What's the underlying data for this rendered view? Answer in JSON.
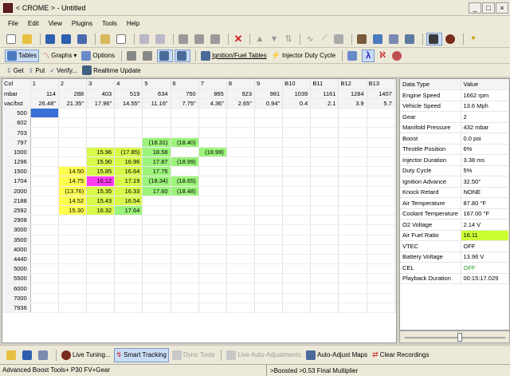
{
  "title": "< CROME > - Untitled",
  "menu": [
    "File",
    "Edit",
    "View",
    "Plugins",
    "Tools",
    "Help"
  ],
  "toolbar2": {
    "tables": "Tables",
    "graphs": "Graphs",
    "options": "Options",
    "ignfuel": "Ignition/Fuel Tables",
    "injdc": "Injector Duty Cycle"
  },
  "toolbar3": {
    "get": "Get",
    "put": "Put",
    "verify": "Verify...",
    "realtime": "Realtime Update"
  },
  "grid": {
    "header": [
      "Col",
      "1",
      "2",
      "3",
      "4",
      "5",
      "6",
      "7",
      "8",
      "9",
      "B10",
      "B11",
      "B12",
      "B13",
      "B14"
    ],
    "mbar": [
      "mbar",
      "114",
      "288",
      "403",
      "519",
      "634",
      "750",
      "865",
      "923",
      "981",
      "1039",
      "1161",
      "1284",
      "1407",
      "1530"
    ],
    "vac": [
      "vac/bst",
      "26.48\"",
      "21.35\"",
      "17.96\"",
      "14.55\"",
      "11.16\"",
      "7.75\"",
      "4.36\"",
      "2.65\"",
      "0.94\"",
      "0.4",
      "2.1",
      "3.9",
      "5.7",
      "7.5"
    ],
    "rows": [
      {
        "rpm": "500",
        "cells": [
          "",
          "",
          "",
          "",
          "",
          "",
          "",
          "",
          "",
          "",
          "",
          "",
          "",
          ""
        ]
      },
      {
        "rpm": "602",
        "cells": [
          "",
          "",
          "",
          "",
          "",
          "",
          "",
          "",
          "",
          "",
          "",
          "",
          "",
          ""
        ]
      },
      {
        "rpm": "703",
        "cells": [
          "",
          "",
          "",
          "",
          "",
          "",
          "",
          "",
          "",
          "",
          "",
          "",
          "",
          ""
        ]
      },
      {
        "rpm": "797",
        "cells": [
          "",
          "",
          "",
          "",
          "(18.31)",
          "(18.40)",
          "",
          "",
          "",
          "",
          "",
          "",
          "",
          ""
        ]
      },
      {
        "rpm": "1000",
        "cells": [
          "",
          "",
          "15.96",
          "(17.85)",
          "18.58",
          "",
          "(18.99)",
          "",
          "",
          "",
          "",
          "",
          "",
          ""
        ]
      },
      {
        "rpm": "1296",
        "cells": [
          "",
          "",
          "15.90",
          "16.96",
          "17.87",
          "(18.99)",
          "",
          "",
          "",
          "",
          "",
          "",
          "",
          ""
        ]
      },
      {
        "rpm": "1500",
        "cells": [
          "",
          "14.50",
          "15.85",
          "16.64",
          "17.75",
          "",
          "",
          "",
          "",
          "",
          "",
          "",
          "",
          ""
        ]
      },
      {
        "rpm": "1704",
        "cells": [
          "",
          "14.75",
          "16.12",
          "17.19",
          "(18.34)",
          "(18.65)",
          "",
          "",
          "",
          "",
          "",
          "",
          "",
          ""
        ]
      },
      {
        "rpm": "2000",
        "cells": [
          "",
          "(13.76)",
          "15.35",
          "16.33",
          "17.60",
          "(18.48)",
          "",
          "",
          "",
          "",
          "",
          "",
          "",
          ""
        ]
      },
      {
        "rpm": "2188",
        "cells": [
          "",
          "14.52",
          "15.43",
          "16.54",
          "",
          "",
          "",
          "",
          "",
          "",
          "",
          "",
          "",
          ""
        ]
      },
      {
        "rpm": "2592",
        "cells": [
          "",
          "15.30",
          "16.32",
          "17.64",
          "",
          "",
          "",
          "",
          "",
          "",
          "",
          "",
          "",
          ""
        ]
      },
      {
        "rpm": "2908",
        "cells": [
          "",
          "",
          "",
          "",
          "",
          "",
          "",
          "",
          "",
          "",
          "",
          "",
          "",
          ""
        ]
      },
      {
        "rpm": "3000",
        "cells": [
          "",
          "",
          "",
          "",
          "",
          "",
          "",
          "",
          "",
          "",
          "",
          "",
          "",
          ""
        ]
      },
      {
        "rpm": "3500",
        "cells": [
          "",
          "",
          "",
          "",
          "",
          "",
          "",
          "",
          "",
          "",
          "",
          "",
          "",
          ""
        ]
      },
      {
        "rpm": "4000",
        "cells": [
          "",
          "",
          "",
          "",
          "",
          "",
          "",
          "",
          "",
          "",
          "",
          "",
          "",
          ""
        ]
      },
      {
        "rpm": "4440",
        "cells": [
          "",
          "",
          "",
          "",
          "",
          "",
          "",
          "",
          "",
          "",
          "",
          "",
          "",
          ""
        ]
      },
      {
        "rpm": "5000",
        "cells": [
          "",
          "",
          "",
          "",
          "",
          "",
          "",
          "",
          "",
          "",
          "",
          "",
          "",
          ""
        ]
      },
      {
        "rpm": "5500",
        "cells": [
          "",
          "",
          "",
          "",
          "",
          "",
          "",
          "",
          "",
          "",
          "",
          "",
          "",
          ""
        ]
      },
      {
        "rpm": "6000",
        "cells": [
          "",
          "",
          "",
          "",
          "",
          "",
          "",
          "",
          "",
          "",
          "",
          "",
          "",
          ""
        ]
      },
      {
        "rpm": "7000",
        "cells": [
          "",
          "",
          "",
          "",
          "",
          "",
          "",
          "",
          "",
          "",
          "",
          "",
          "",
          ""
        ]
      },
      {
        "rpm": "7936",
        "cells": [
          "",
          "",
          "",
          "",
          "",
          "",
          "",
          "",
          "",
          "",
          "",
          "",
          "",
          ""
        ]
      }
    ],
    "colors": {
      "yellow": "#ffff50",
      "green": "#9cf47a",
      "lime": "#d8f84a",
      "magenta": "#ff3cf0",
      "selected": "#3a6fd8"
    }
  },
  "datatable": {
    "header": [
      "Data Type",
      "Value"
    ],
    "rows": [
      [
        "Engine Speed",
        "1662 rpm"
      ],
      [
        "Vehicle Speed",
        "13.6 Mph"
      ],
      [
        "Gear",
        "2"
      ],
      [
        "Manifold Pressure",
        "432 mbar"
      ],
      [
        "Boost",
        "0.0 psi"
      ],
      [
        "Throttle Position",
        "6%"
      ],
      [
        "Injector Duration",
        "3.38 ms"
      ],
      [
        "Duty Cycle",
        "5%"
      ],
      [
        "Ignition Advance",
        "32.50°"
      ],
      [
        "Knock Retard",
        "NONE"
      ],
      [
        "Air Temperature",
        "87.80 °F"
      ],
      [
        "Coolant Temperature",
        "167.00 °F"
      ],
      [
        "O2 Voltage",
        "2.14 V"
      ],
      [
        "Air Fuel Ratio",
        "16.11"
      ],
      [
        "VTEC",
        "OFF"
      ],
      [
        "Battery Voltage",
        "13.96 V"
      ],
      [
        "CEL",
        "OFF"
      ],
      [
        "Playback Duration",
        "00:15:17.029"
      ]
    ]
  },
  "bottom": {
    "live": "Live Tuning...",
    "smart": "Smart Tracking",
    "dyno": "Dyno Tools",
    "liveauto": "Live Auto-Adjustments",
    "autoadj": "Auto-Adjust Maps",
    "clear": "Clear Recordings"
  },
  "status": {
    "left": "Advanced Boost Tools+ P30 FV+Gear",
    "right": ">Boosted >0.53 Final Multiplier"
  }
}
